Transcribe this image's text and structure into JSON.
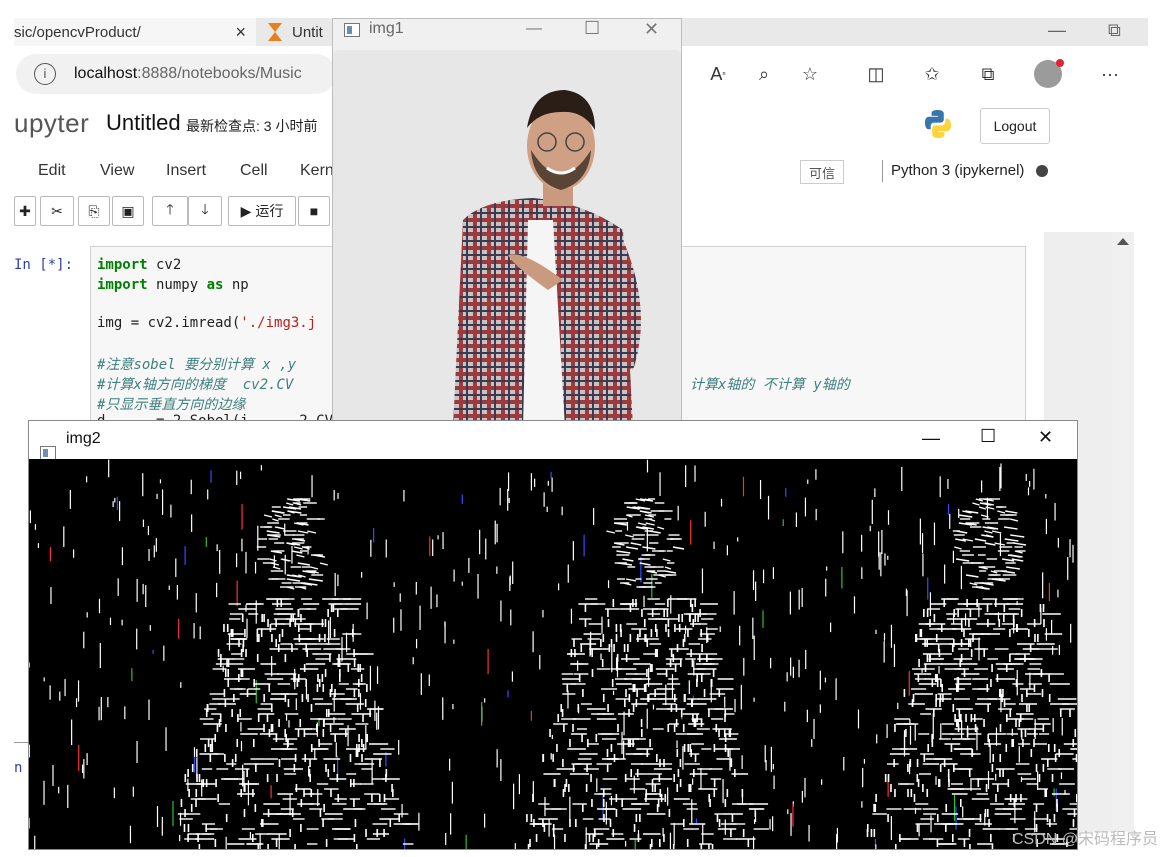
{
  "browser": {
    "tab1_title": "sic/opencvProduct/",
    "tab1_close": "×",
    "tab2_title": "Untit",
    "url_host": "localhost",
    "url_path": ":8888/notebooks/Music",
    "window_controls": {
      "minimize": "—",
      "restore": "⧉"
    },
    "toolbar_icons": [
      "read-aloud-icon",
      "zoom-icon",
      "add-favorite-icon",
      "split-screen-icon",
      "favorites-icon",
      "collections-icon",
      "profile-icon",
      "more-icon"
    ]
  },
  "jupyter": {
    "logo_text": "upyter",
    "notebook_title": "Untitled",
    "checkpoint_label": "最新检查点: 3 小时前",
    "logout_label": "Logout",
    "menu": [
      "Edit",
      "View",
      "Insert",
      "Cell",
      "Kern"
    ],
    "trusted_label": "可信",
    "kernel_label": "Python 3 (ipykernel)",
    "run_label": "运行",
    "cell_prompt": "In [*]:",
    "left_prompt": "n"
  },
  "code": {
    "l1_kw": "import",
    "l1_rest": " cv2",
    "l2_kw": "import",
    "l2_mid": " numpy ",
    "l2_kw2": "as",
    "l2_rest": " np",
    "l3_pre": "img = cv2.imread(",
    "l3_str": "'./img3.j",
    "c1": "#注意sobel 要分别计算 x ,y",
    "c2": "#计算x轴方向的梯度  cv2.CV",
    "c2b": "计算x轴的 不计算 y轴的",
    "c3": "#只显示垂直方向的边缘",
    "l4_partial": "d      = 2.Sobel(i      2.CV"
  },
  "windows": {
    "img1_title": "img1",
    "img2_title": "img2",
    "ctrl_min": "—",
    "ctrl_max": "☐",
    "ctrl_close": "✕"
  },
  "watermark": "CSDN @宋码程序员",
  "colors": {
    "code_keyword": "#008000",
    "code_comment": "#408080",
    "prompt": "#303f9f",
    "tab_hourglass": "#e8801e"
  }
}
